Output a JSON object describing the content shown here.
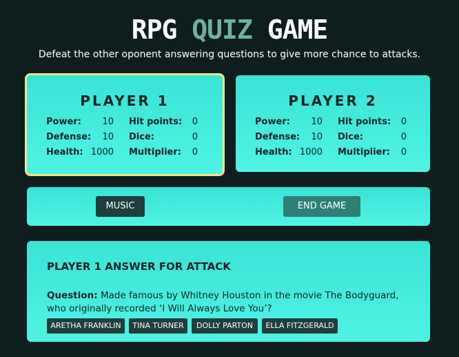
{
  "header": {
    "title_part1": "RPG",
    "title_accent": "QUIZ",
    "title_part2": "GAME",
    "subtitle": "Defeat the other oponent answering questions to give more chance to attacks."
  },
  "players": [
    {
      "name": "PLAYER 1",
      "active": true,
      "power_label": "Power:",
      "power": "10",
      "defense_label": "Defense:",
      "defense": "10",
      "health_label": "Health:",
      "health": "1000",
      "hit_points_label": "Hit points:",
      "hit_points": "0",
      "dice_label": "Dice:",
      "dice": "0",
      "multiplier_label": "Multiplier:",
      "multiplier": "0"
    },
    {
      "name": "PLAYER 2",
      "active": false,
      "power_label": "Power:",
      "power": "10",
      "defense_label": "Defense:",
      "defense": "10",
      "health_label": "Health:",
      "health": "1000",
      "hit_points_label": "Hit points:",
      "hit_points": "0",
      "dice_label": "Dice:",
      "dice": "0",
      "multiplier_label": "Multiplier:",
      "multiplier": "0"
    }
  ],
  "controls": {
    "music_label": "MUSIC",
    "end_game_label": "END GAME"
  },
  "question_panel": {
    "heading": "PLAYER 1 ANSWER FOR ATTACK",
    "question_label": "Question:",
    "question_text": "Made famous by Whitney Houston in the movie The Bodyguard, who originally recorded ‘I Will Always Love You’?",
    "answers": [
      "ARETHA FRANKLIN",
      "TINA TURNER",
      "DOLLY PARTON",
      "ELLA FITZGERALD"
    ]
  },
  "colors": {
    "background": "#0e1d1e",
    "card": "#45eee0",
    "active_border": "#f2e38a",
    "button_dark": "#1f3e3d",
    "button_teal": "#2e8074",
    "title_accent": "#6fb1a0"
  }
}
